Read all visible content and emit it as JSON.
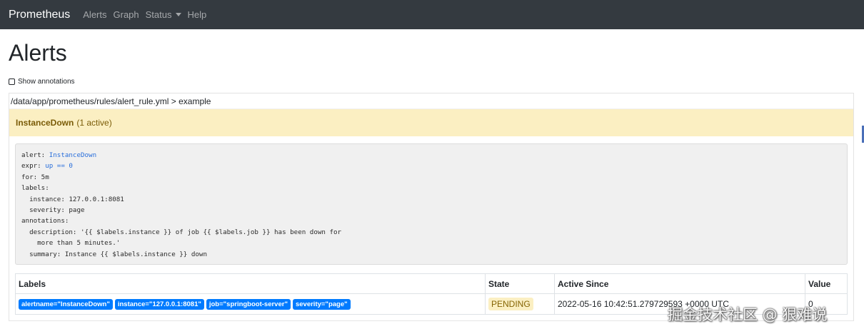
{
  "navbar": {
    "brand": "Prometheus",
    "links": [
      "Alerts",
      "Graph",
      "Status",
      "Help"
    ]
  },
  "page": {
    "title": "Alerts",
    "show_annotations_label": "Show annotations"
  },
  "group": {
    "path": "/data/app/prometheus/rules/alert_rule.yml > example",
    "alert": {
      "name": "InstanceDown",
      "count_text": "(1 active)"
    },
    "rule": {
      "alert_key": "alert: ",
      "alert_val": "InstanceDown",
      "expr_key": "expr: ",
      "expr_val": "up == 0",
      "lines": [
        "for: 5m",
        "labels:",
        "  instance: 127.0.0.1:8081",
        "  severity: page",
        "annotations:",
        "  description: '{{ $labels.instance }} of job {{ $labels.job }} has been down for",
        "    more than 5 minutes.'",
        "  summary: Instance {{ $labels.instance }} down"
      ]
    },
    "table": {
      "headers": [
        "Labels",
        "State",
        "Active Since",
        "Value"
      ],
      "rows": [
        {
          "labels": [
            "alertname=\"InstanceDown\"",
            "instance=\"127.0.0.1:8081\"",
            "job=\"springboot-server\"",
            "severity=\"page\""
          ],
          "state": "PENDING",
          "active_since": "2022-05-16 10:42:51.279729593 +0000 UTC",
          "value": "0"
        }
      ]
    }
  },
  "watermark": "掘金技术社区 @ 狠难说"
}
